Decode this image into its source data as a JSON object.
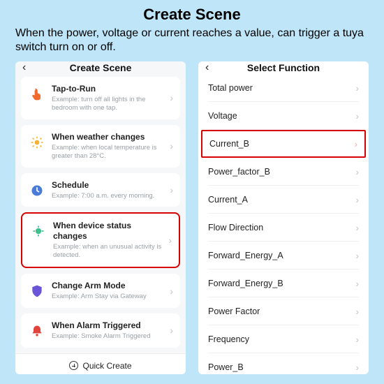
{
  "title": "Create Scene",
  "subtitle": "When the power, voltage or current reaches a value, can trigger a tuya switch turn on or off.",
  "left": {
    "header": "Create Scene",
    "items": [
      {
        "title": "Tap-to-Run",
        "sub": "Example: turn off all lights in the bedroom with one tap."
      },
      {
        "title": "When weather changes",
        "sub": "Example: when local temperature is greater than 28°C."
      },
      {
        "title": "Schedule",
        "sub": "Example: 7:00 a.m. every morning."
      },
      {
        "title": "When device status changes",
        "sub": "Example: when an unusual activity is detected."
      },
      {
        "title": "Change Arm Mode",
        "sub": "Example: Arm Stay via Gateway"
      },
      {
        "title": "When Alarm Triggered",
        "sub": "Example: Smoke Alarm Triggered"
      }
    ],
    "quick_create": "Quick Create"
  },
  "right": {
    "header": "Select Function",
    "items": [
      {
        "label": "Total power"
      },
      {
        "label": "Voltage"
      },
      {
        "label": "Current_B"
      },
      {
        "label": "Power_factor_B"
      },
      {
        "label": "Current_A"
      },
      {
        "label": "Flow Direction"
      },
      {
        "label": "Forward_Energy_A"
      },
      {
        "label": "Forward_Energy_B"
      },
      {
        "label": "Power Factor"
      },
      {
        "label": "Frequency"
      },
      {
        "label": "Power_B"
      }
    ]
  }
}
